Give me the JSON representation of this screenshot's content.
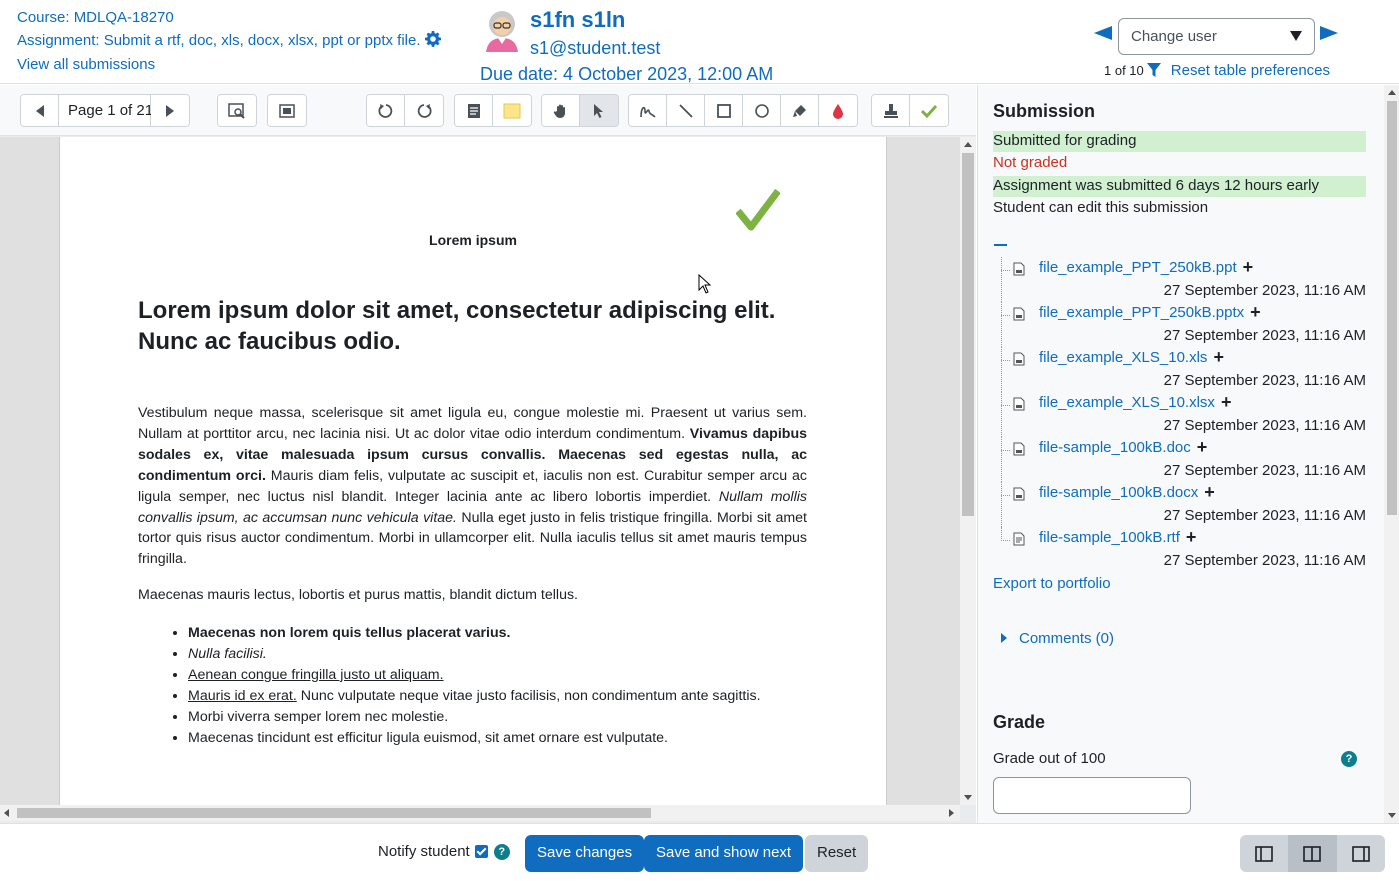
{
  "header": {
    "course": "Course: MDLQA-18270",
    "assignment": "Assignment: Submit a rtf, doc, xls, docx, xlsx, ppt or pptx file.",
    "view_all": "View all submissions",
    "user_name": "s1fn s1ln",
    "user_email": "s1@student.test",
    "due_date": "Due date: 4 October 2023, 12:00 AM",
    "change_user_placeholder": "Change user",
    "count": "1 of 10",
    "reset_prefs": "Reset table preferences"
  },
  "toolbar": {
    "page_label": "Page 1 of 21"
  },
  "document": {
    "small_title": "Lorem ipsum",
    "title": "Lorem ipsum dolor sit amet, consectetur adipiscing elit. Nunc ac faucibus odio.",
    "para1_a": "Vestibulum neque massa, scelerisque sit amet ligula eu, congue molestie mi. Praesent ut varius sem. Nullam at porttitor arcu, nec lacinia nisi. Ut ac dolor vitae odio interdum condimentum. ",
    "para1_bold": "Vivamus dapibus sodales ex, vitae malesuada ipsum cursus convallis. Maecenas sed egestas nulla, ac condimentum orci.",
    "para1_b": " Mauris diam felis, vulputate ac suscipit et, iaculis non est. Curabitur semper arcu ac ligula semper, nec luctus nisl blandit. Integer lacinia ante ac libero lobortis imperdiet. ",
    "para1_italic": "Nullam mollis convallis ipsum, ac accumsan nunc vehicula vitae.",
    "para1_c": " Nulla eget justo in felis tristique fringilla. Morbi sit amet tortor quis risus auctor condimentum. Morbi in ullamcorper elit. Nulla iaculis tellus sit amet mauris tempus fringilla.",
    "para2": "Maecenas mauris lectus, lobortis et purus mattis, blandit dictum tellus.",
    "list": {
      "item1": "Maecenas non lorem quis tellus placerat varius.",
      "item2": "Nulla facilisi.",
      "item3": "Aenean congue fringilla justo ut aliquam.",
      "item4_u": "Mauris id ex erat.",
      "item4_rest": " Nunc vulputate neque vitae justo facilisis, non condimentum ante sagittis.",
      "item5": "Morbi viverra semper lorem nec molestie.",
      "item6": "Maecenas tincidunt est efficitur ligula euismod, sit amet ornare est vulputate."
    }
  },
  "submission": {
    "heading": "Submission",
    "status1": "Submitted for grading",
    "status2": "Not graded",
    "status3": "Assignment was submitted 6 days 12 hours early",
    "status4": "Student can edit this submission",
    "files": [
      {
        "name": "file_example_PPT_250kB.ppt",
        "date": "27 September 2023, 11:16 AM"
      },
      {
        "name": "file_example_PPT_250kB.pptx",
        "date": "27 September 2023, 11:16 AM"
      },
      {
        "name": "file_example_XLS_10.xls",
        "date": "27 September 2023, 11:16 AM"
      },
      {
        "name": "file_example_XLS_10.xlsx",
        "date": "27 September 2023, 11:16 AM"
      },
      {
        "name": "file-sample_100kB.doc",
        "date": "27 September 2023, 11:16 AM"
      },
      {
        "name": "file-sample_100kB.docx",
        "date": "27 September 2023, 11:16 AM"
      },
      {
        "name": "file-sample_100kB.rtf",
        "date": "27 September 2023, 11:16 AM"
      }
    ],
    "export": "Export to portfolio",
    "comments": "Comments (0)"
  },
  "grade": {
    "heading": "Grade",
    "label": "Grade out of 100"
  },
  "footer": {
    "notify": "Notify student",
    "save": "Save changes",
    "save_next": "Save and show next",
    "reset": "Reset"
  },
  "colors": {
    "accent": "#0f6cbf",
    "success_bg": "#d1f0cf",
    "danger": "#ca3120",
    "check_green": "#7cb342"
  }
}
